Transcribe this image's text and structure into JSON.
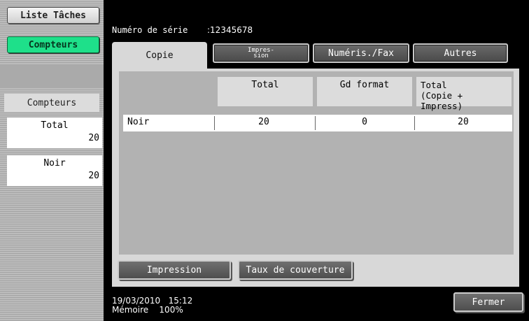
{
  "sidebar": {
    "jobs_button": "Liste Tâches",
    "counters_button": "Compteurs",
    "section_title": "Compteurs",
    "cards": [
      {
        "label": "Total",
        "value": "20"
      },
      {
        "label": "Noir",
        "value": "20"
      }
    ]
  },
  "header": {
    "serial_label": "Numéro de série",
    "serial_value": ":12345678"
  },
  "tabs": {
    "copie": "Copie",
    "impression_line1": "Impres-",
    "impression_line2": "sion",
    "numeris": "Numéris./Fax",
    "autres": "Autres"
  },
  "table": {
    "headers": {
      "total": "Total",
      "gd_format": "Gd format",
      "sum_line1": "Total",
      "sum_line2": "(Copie + Impress)"
    },
    "rows": [
      {
        "label": "Noir",
        "total": "20",
        "gd_format": "0",
        "sum": "20"
      }
    ]
  },
  "buttons": {
    "impression": "Impression",
    "taux": "Taux de couverture",
    "fermer": "Fermer"
  },
  "footer": {
    "date": "19/03/2010",
    "time": "15:12",
    "memory_label": "Mémoire",
    "memory_value": "100%"
  },
  "colors": {
    "active_green": "#1ee08a",
    "panel_gray": "#d8d8d8",
    "background": "#000000"
  }
}
